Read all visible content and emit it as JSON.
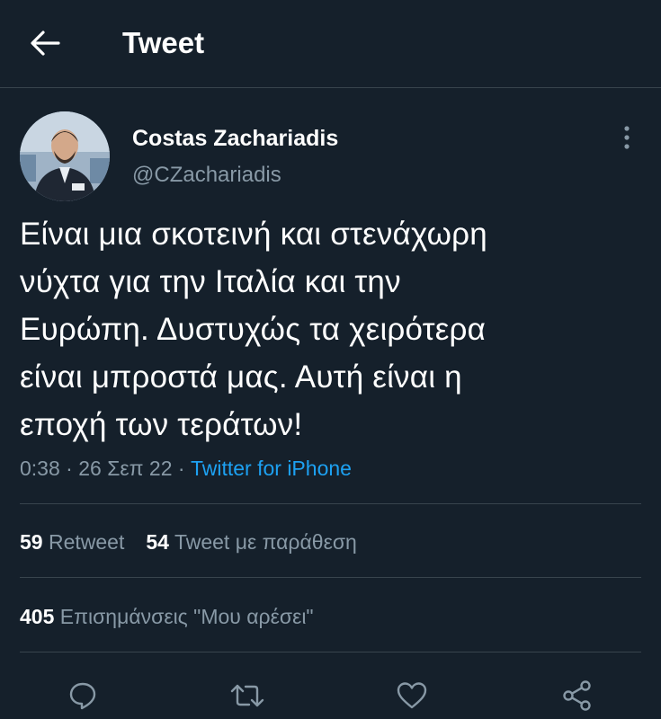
{
  "header": {
    "title": "Tweet"
  },
  "author": {
    "name": "Costas  Zachariadis",
    "handle": "@CZachariadis"
  },
  "tweet": {
    "text": "Είναι μια σκοτεινή και στενάχωρη\nνύχτα για την Ιταλία και την\nΕυρώπη. Δυστυχώς τα χειρότερα\nείναι μπροστά μας. Αυτή είναι η\nεποχή των τεράτων!",
    "time": "0:38",
    "date": "26 Σεπ 22",
    "separator": "·",
    "source": "Twitter for iPhone"
  },
  "stats": {
    "retweets_count": "59",
    "retweets_label": "Retweet",
    "quotes_count": "54",
    "quotes_label": "Tweet με παράθεση",
    "likes_count": "405",
    "likes_label": "Επισημάνσεις \"Μου αρέσει\""
  },
  "actions": [
    "reply-icon",
    "retweet-icon",
    "like-icon",
    "share-icon"
  ],
  "colors": {
    "background": "#15202b",
    "text": "#ffffff",
    "secondary_text": "#8899a6",
    "accent": "#1da1f2",
    "divider": "#38444d"
  }
}
